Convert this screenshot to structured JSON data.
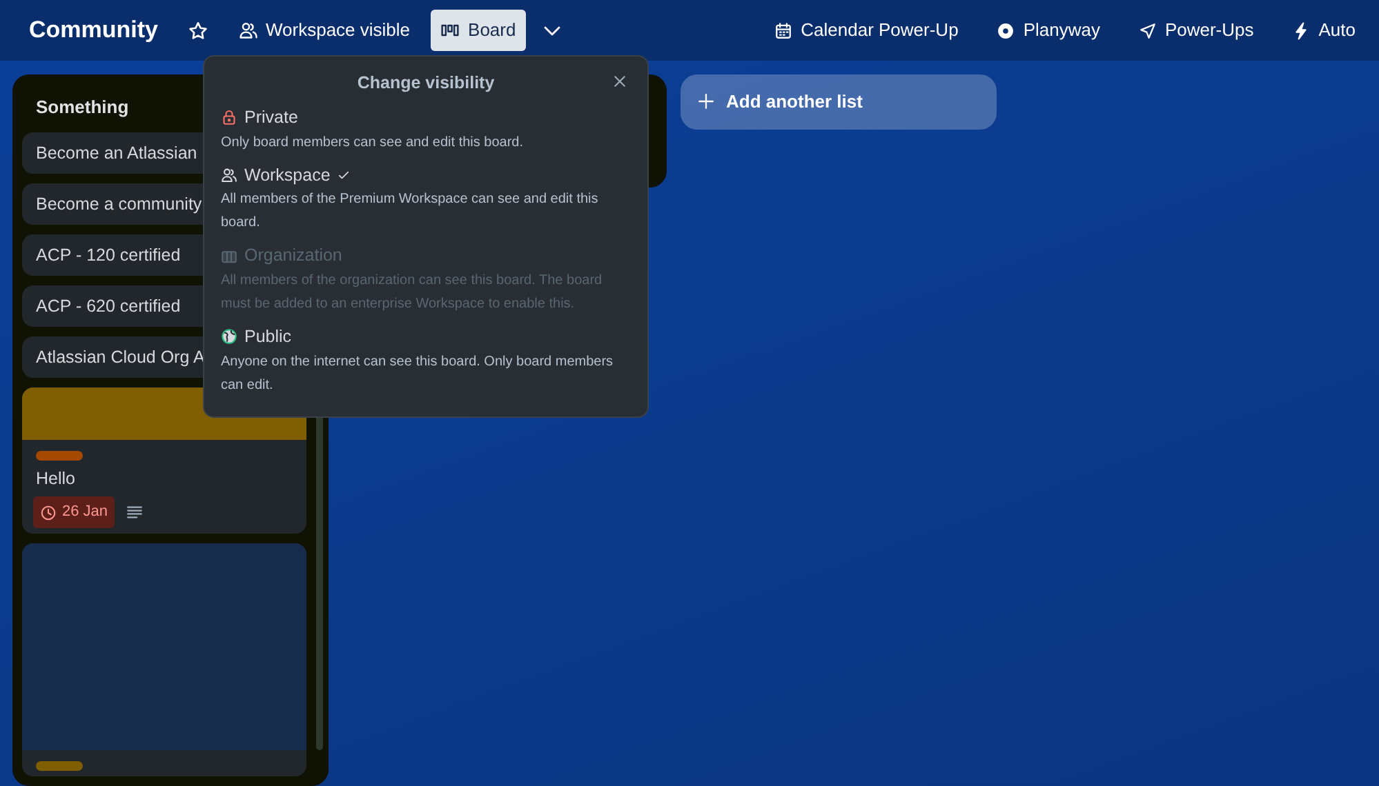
{
  "header": {
    "title": "Community",
    "visibility": "Workspace visible",
    "view": {
      "label": "Board",
      "selected": true
    },
    "actions": [
      {
        "kind": "calendar",
        "label": "Calendar Power-Up"
      },
      {
        "kind": "planyway",
        "label": "Planyway"
      },
      {
        "kind": "rocket",
        "label": "Power-Ups"
      },
      {
        "kind": "bolt",
        "label": "Auto"
      }
    ]
  },
  "list": {
    "title": "Something",
    "cards": [
      {
        "kind": "text",
        "title": "Become an Atlassian"
      },
      {
        "kind": "text",
        "title": "Become a community"
      },
      {
        "kind": "text",
        "title": "ACP - 120 certified"
      },
      {
        "kind": "text",
        "title": "ACP - 620 certified"
      },
      {
        "kind": "text",
        "title": "Atlassian Cloud Org A"
      },
      {
        "kind": "cover",
        "cover": {
          "color": "#7f5f01"
        },
        "labels": [
          {
            "color": "#a54800"
          }
        ],
        "title": "Hello",
        "due": "26 Jan"
      },
      {
        "kind": "cover",
        "cover": {
          "color": "#172b4d"
        },
        "labels": [
          {
            "color": "#7f5f01"
          }
        ]
      }
    ]
  },
  "add_list": "Add another list",
  "popover": {
    "title": "Change visibility",
    "options": [
      {
        "kind": "lock",
        "label": "Private",
        "description": "Only board members can see and edit this board.",
        "selected": false,
        "disabled": false
      },
      {
        "kind": "people",
        "label": "Workspace",
        "description": "All members of the Premium Workspace can see and edit this board.",
        "selected": true,
        "disabled": false
      },
      {
        "kind": "org",
        "label": "Organization",
        "description": "All members of the organization can see this board. The board must be added to an enterprise Workspace to enable this.",
        "selected": false,
        "disabled": true
      },
      {
        "kind": "globe",
        "label": "Public",
        "description": "Anyone on the internet can see this board. Only board members can edit.",
        "selected": false,
        "disabled": false
      }
    ]
  }
}
